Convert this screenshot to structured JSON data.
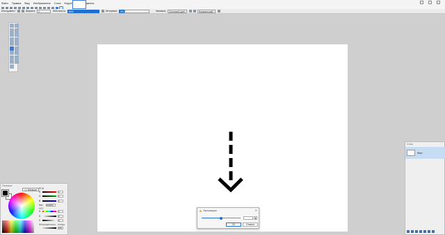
{
  "menu": [
    "Файл",
    "Правка",
    "Вид",
    "Изображение",
    "Слои",
    "Коррекция",
    "Эффекты"
  ],
  "options": {
    "tool_label": "Инструмент:",
    "width_label": "Ширина:",
    "width_value": "2",
    "hardness_label": "Жёсткость:",
    "hardness_value": "50%",
    "antialias_label": "Интервал:",
    "antialias_value": "0%",
    "sampling_label": "Заливка:",
    "sampling_value": "Основной цвет",
    "blend_value": "Нормальный"
  },
  "layers": {
    "title": "Слои",
    "items": [
      {
        "name": "Фон"
      }
    ]
  },
  "colors": {
    "title": "Палитра",
    "less_button": "<< Меньше",
    "rgb_label": "RGB",
    "r": "0",
    "g": "0",
    "b": "0",
    "hex_label": "Hex",
    "hex_value": "000000",
    "hsv_label": "HSV",
    "h": "0",
    "s": "0",
    "v": "0",
    "opacity_label": "Непрозрачность - Альфа",
    "opacity_value": "255",
    "primary": "#000000",
    "secondary": "#ffffff"
  },
  "dialog": {
    "title": "Экспозиция",
    "close": "✕",
    "slider_fraction": 0.5,
    "ok_label": "OK",
    "cancel_label": "Отмена"
  },
  "accent_color": "#1f6fd0"
}
